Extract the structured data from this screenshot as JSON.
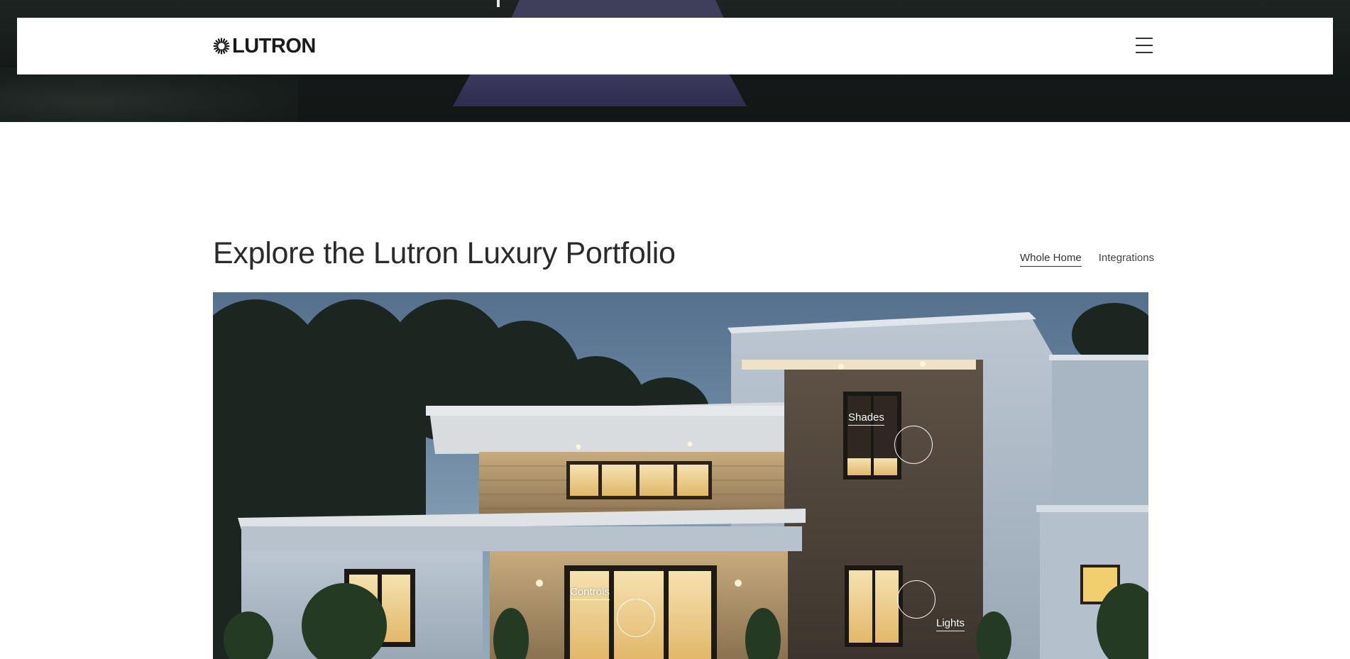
{
  "brand": {
    "name": "LUTRON"
  },
  "header": {
    "menu_icon": "hamburger-menu-icon"
  },
  "section": {
    "title": "Explore the Lutron Luxury Portfolio",
    "tabs": [
      {
        "label": "Whole Home",
        "active": true
      },
      {
        "label": "Integrations",
        "active": false
      }
    ]
  },
  "hotspots": [
    {
      "label": "Shades"
    },
    {
      "label": "Controls"
    },
    {
      "label": "Lights"
    }
  ],
  "colors": {
    "header_bg": "#ffffff",
    "hero_bg": "#161b1a",
    "title_text": "#2b2b2b"
  }
}
